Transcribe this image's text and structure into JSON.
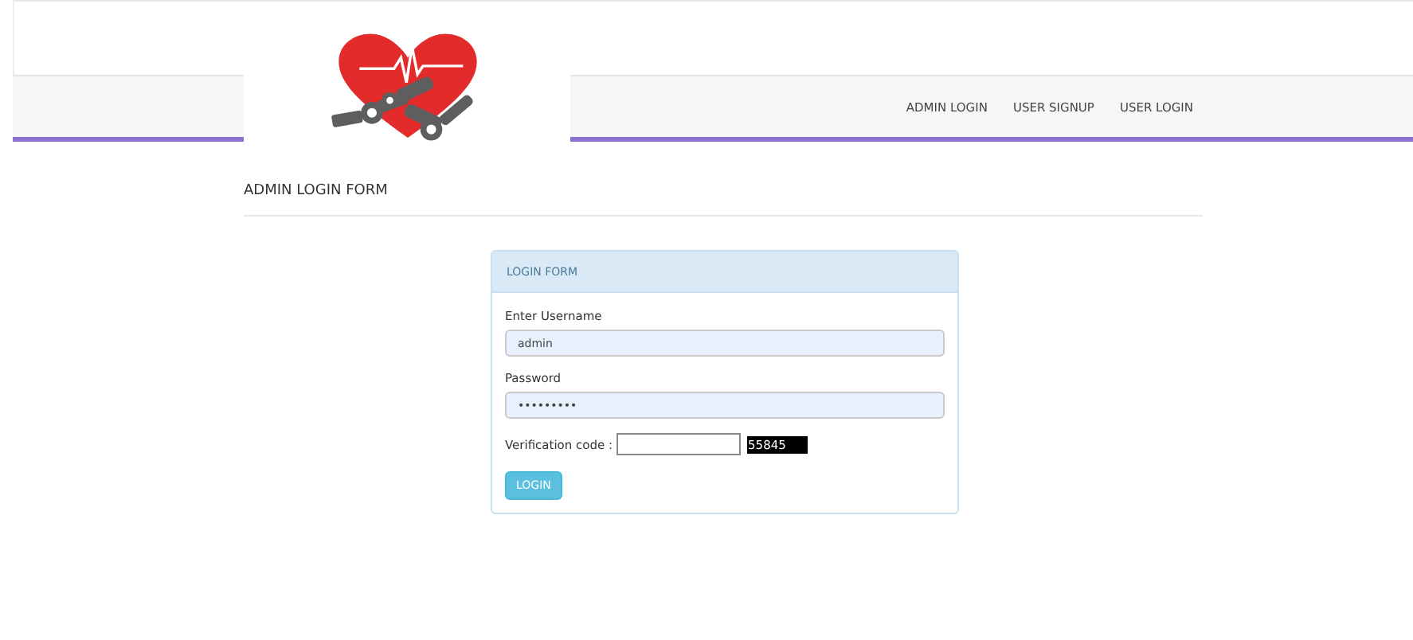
{
  "nav": {
    "links": [
      {
        "label": "ADMIN LOGIN"
      },
      {
        "label": "USER SIGNUP"
      },
      {
        "label": "USER LOGIN"
      }
    ]
  },
  "page_title": "ADMIN LOGIN FORM",
  "panel": {
    "heading": "LOGIN FORM",
    "username": {
      "label": "Enter Username",
      "value": "admin"
    },
    "password": {
      "label": "Password",
      "value": "•••••••••"
    },
    "verification": {
      "label": "Verification code :",
      "code": "55845"
    },
    "button": "LOGIN"
  }
}
